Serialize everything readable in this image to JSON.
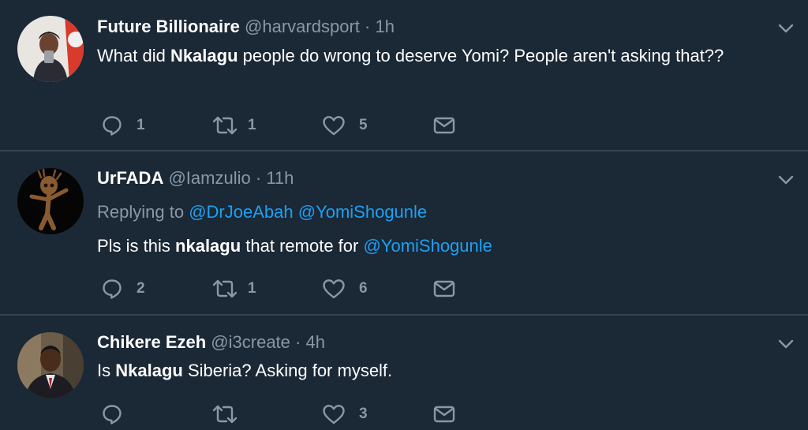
{
  "tweets": [
    {
      "name": "Future Billionaire",
      "handle": "@harvardsport",
      "dot": "·",
      "time": "1h",
      "text_before": "What did ",
      "text_bold": "Nkalagu",
      "text_after": " people do wrong to deserve Yomi? People aren't asking that??",
      "reply_count": "1",
      "retweet_count": "1",
      "like_count": "5"
    },
    {
      "name": "UrFADA",
      "handle": "@Iamzulio",
      "dot": "·",
      "time": "11h",
      "replying_label": "Replying to",
      "reply_mention_1": "@DrJoeAbah",
      "reply_mention_2": "@YomiShogunle",
      "text_before": "Pls is this ",
      "text_bold": "nkalagu",
      "text_after": " that remote for ",
      "text_mention": "@YomiShogunle",
      "reply_count": "2",
      "retweet_count": "1",
      "like_count": "6"
    },
    {
      "name": "Chikere Ezeh",
      "handle": "@i3create",
      "dot": "·",
      "time": "4h",
      "text_before": "Is ",
      "text_bold": "Nkalagu",
      "text_after": " Siberia? Asking for myself.",
      "reply_count": "",
      "retweet_count": "",
      "like_count": "3"
    }
  ],
  "colors": {
    "background": "#1b2836",
    "divider": "#38444d",
    "secondary_text": "#8899a6",
    "link": "#1da1f2"
  },
  "icons": [
    "reply-icon",
    "retweet-icon",
    "like-icon",
    "dm-icon",
    "chevron-down-icon"
  ]
}
